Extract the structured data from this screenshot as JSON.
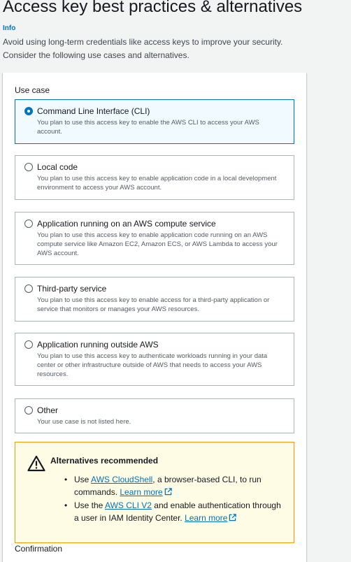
{
  "header": {
    "title": "Access key best practices & alternatives",
    "info": "Info",
    "description": "Avoid using long-term credentials like access keys to improve your security. Consider the following use cases and alternatives."
  },
  "use_case": {
    "label": "Use case",
    "selected_index": 0,
    "options": [
      {
        "title": "Command Line Interface (CLI)",
        "description": "You plan to use this access key to enable the AWS CLI to access your AWS account."
      },
      {
        "title": "Local code",
        "description": "You plan to use this access key to enable application code in a local development environment to access your AWS account."
      },
      {
        "title": "Application running on an AWS compute service",
        "description": "You plan to use this access key to enable application code running on an AWS compute service like Amazon EC2, Amazon ECS, or AWS Lambda to access your AWS account."
      },
      {
        "title": "Third-party service",
        "description": "You plan to use this access key to enable access for a third-party application or service that monitors or manages your AWS resources."
      },
      {
        "title": "Application running outside AWS",
        "description": "You plan to use this access key to authenticate workloads running in your data center or other infrastructure outside of AWS that needs to access your AWS resources."
      },
      {
        "title": "Other",
        "description": "Your use case is not listed here."
      }
    ]
  },
  "alert": {
    "title": "Alternatives recommended",
    "item1": {
      "prefix": "Use ",
      "link": "AWS CloudShell",
      "middle": ", a browser-based CLI, to run commands. ",
      "learn_more": "Learn more"
    },
    "item2": {
      "prefix": "Use the ",
      "link": "AWS CLI V2",
      "middle": " and enable authentication through a user in IAM Identity Center. ",
      "learn_more": "Learn more"
    }
  },
  "confirmation": {
    "label": "Confirmation"
  },
  "colors": {
    "accent": "#0073bb",
    "warning_border": "#ff9900",
    "warning_bg": "#fffce6"
  }
}
